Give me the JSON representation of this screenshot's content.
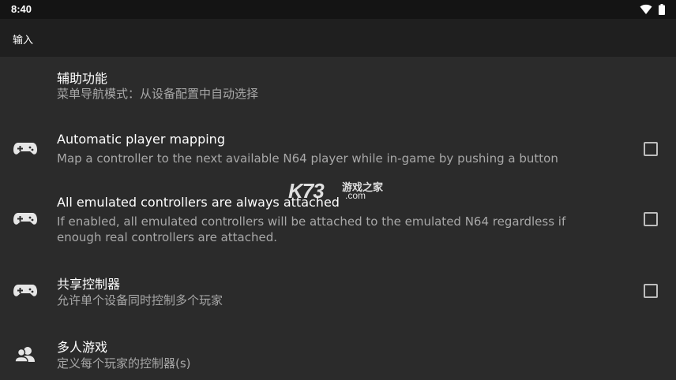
{
  "status_bar": {
    "time": "8:40",
    "icons": [
      "wifi-icon",
      "battery-icon"
    ]
  },
  "app_bar": {
    "title": "输入"
  },
  "items": [
    {
      "title": "辅助功能",
      "summary": "菜单导航模式：从设备配置中自动选择",
      "icon": null,
      "has_checkbox": false
    },
    {
      "title": "Automatic player mapping",
      "summary": "Map a controller to the next available N64 player while in-game by pushing a button",
      "icon": "gamepad-icon",
      "has_checkbox": true,
      "checked": false
    },
    {
      "title": "All emulated controllers are always attached",
      "summary": "If enabled, all emulated controllers will be attached to the emulated N64 regardless if enough real controllers are attached.",
      "icon": "gamepad-icon",
      "has_checkbox": true,
      "checked": false
    },
    {
      "title": "共享控制器",
      "summary": "允许单个设备同时控制多个玩家",
      "icon": "gamepad-icon",
      "has_checkbox": true,
      "checked": false
    },
    {
      "title": "多人游戏",
      "summary": "定义每个玩家的控制器(s)",
      "icon": "users-icon",
      "has_checkbox": false
    }
  ],
  "watermark": {
    "brand": "K73",
    "cn": "游戏之家",
    "domain": ".com"
  },
  "colors": {
    "background": "#2b2b2b",
    "app_bar": "#1f1f1f",
    "status_bar": "#141414",
    "title_text": "#ffffff",
    "summary_text": "#a8a8a8",
    "checkbox_border": "#bdbdbd"
  }
}
